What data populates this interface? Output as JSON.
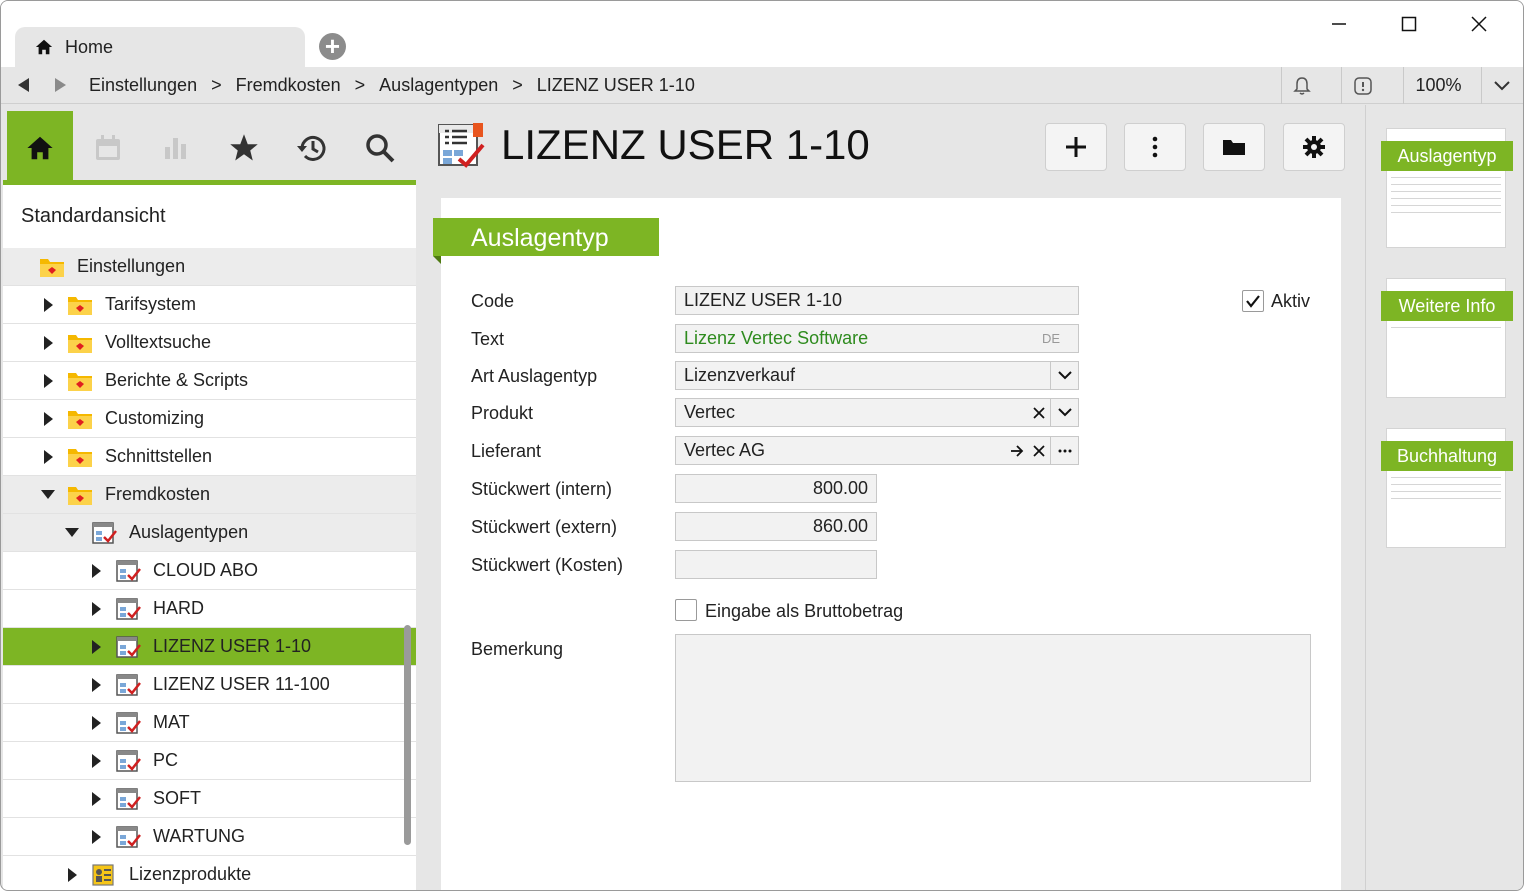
{
  "tab": {
    "label": "Home"
  },
  "window": {
    "zoom": "100%"
  },
  "breadcrumb": [
    "Einstellungen",
    "Fremdkosten",
    "Auslagentypen",
    "LIZENZ USER 1-10"
  ],
  "breadcrumb_sep": ">",
  "sidebar": {
    "view_title": "Standardansicht",
    "toolbar_icons": [
      "home-icon",
      "calendar-icon",
      "chart-icon",
      "star-icon",
      "history-icon",
      "search-icon"
    ],
    "tree": [
      {
        "label": "Einstellungen",
        "level": 0,
        "expanded": true
      },
      {
        "label": "Tarifsystem",
        "level": 1
      },
      {
        "label": "Volltextsuche",
        "level": 1
      },
      {
        "label": "Berichte & Scripts",
        "level": 1
      },
      {
        "label": "Customizing",
        "level": 1
      },
      {
        "label": "Schnittstellen",
        "level": 1
      },
      {
        "label": "Fremdkosten",
        "level": 1,
        "expanded": true
      },
      {
        "label": "Auslagentypen",
        "level": 2,
        "expanded": true
      },
      {
        "label": "CLOUD ABO",
        "level": 3
      },
      {
        "label": "HARD",
        "level": 3
      },
      {
        "label": "LIZENZ USER 1-10",
        "level": 3,
        "selected": true
      },
      {
        "label": "LIZENZ USER 11-100",
        "level": 3
      },
      {
        "label": "MAT",
        "level": 3
      },
      {
        "label": "PC",
        "level": 3
      },
      {
        "label": "SOFT",
        "level": 3
      },
      {
        "label": "WARTUNG",
        "level": 3
      },
      {
        "label": "Lizenzprodukte",
        "level": 2
      }
    ]
  },
  "main": {
    "title": "LIZENZ USER 1-10",
    "section": "Auslagentyp",
    "fields": {
      "code": {
        "label": "Code",
        "value": "LIZENZ USER 1-10"
      },
      "aktiv": {
        "label": "Aktiv",
        "checked": true
      },
      "text": {
        "label": "Text",
        "value": "Lizenz Vertec Software",
        "lang": "DE"
      },
      "art": {
        "label": "Art Auslagentyp",
        "value": "Lizenzverkauf"
      },
      "produkt": {
        "label": "Produkt",
        "value": "Vertec"
      },
      "lieferant": {
        "label": "Lieferant",
        "value": "Vertec AG"
      },
      "stk_intern": {
        "label": "Stückwert (intern)",
        "value": "800.00"
      },
      "stk_extern": {
        "label": "Stückwert (extern)",
        "value": "860.00"
      },
      "stk_kosten": {
        "label": "Stückwert (Kosten)",
        "value": ""
      },
      "brutto": {
        "label": "Eingabe als Bruttobetrag",
        "checked": false
      },
      "bemerkung": {
        "label": "Bemerkung",
        "value": ""
      }
    }
  },
  "rightpanel": {
    "pages": [
      "Auslagentyp",
      "Weitere Info",
      "Buchhaltung"
    ]
  },
  "colors": {
    "accent": "#7db524",
    "text_green": "#2e8b1e"
  }
}
